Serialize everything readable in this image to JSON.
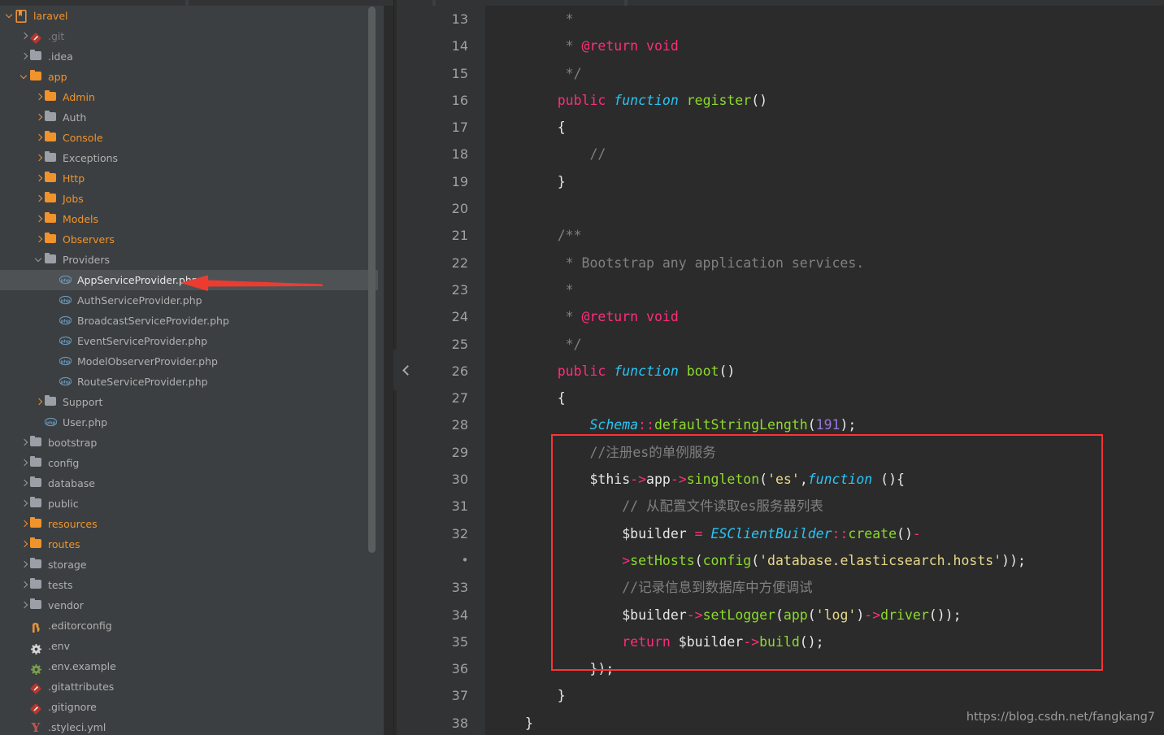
{
  "window": {
    "watermark": "https://blog.csdn.net/fangkang7"
  },
  "sidebar": {
    "scrollbar_label": "project-tree-scrollbar",
    "tree": [
      {
        "label": "laravel",
        "depth": 0,
        "icon": "module-book-icon",
        "arrow": "open-orange",
        "color": "orange",
        "selected": false
      },
      {
        "label": ".git",
        "depth": 1,
        "icon": "git-icon",
        "arrow": "closed",
        "color": "dim",
        "selected": false
      },
      {
        "label": ".idea",
        "depth": 1,
        "icon": "folder-grey-icon",
        "arrow": "closed",
        "color": "grey",
        "selected": false
      },
      {
        "label": "app",
        "depth": 1,
        "icon": "folder-orange-icon",
        "arrow": "open-orange",
        "color": "orange",
        "selected": false
      },
      {
        "label": "Admin",
        "depth": 2,
        "icon": "folder-orange-icon",
        "arrow": "closed-orange",
        "color": "orange",
        "selected": false
      },
      {
        "label": "Auth",
        "depth": 2,
        "icon": "folder-grey-icon",
        "arrow": "closed-orange",
        "color": "grey",
        "selected": false
      },
      {
        "label": "Console",
        "depth": 2,
        "icon": "folder-orange-icon",
        "arrow": "closed-orange",
        "color": "orange",
        "selected": false
      },
      {
        "label": "Exceptions",
        "depth": 2,
        "icon": "folder-grey-icon",
        "arrow": "closed-orange",
        "color": "grey",
        "selected": false
      },
      {
        "label": "Http",
        "depth": 2,
        "icon": "folder-orange-icon",
        "arrow": "closed-orange",
        "color": "orange",
        "selected": false
      },
      {
        "label": "Jobs",
        "depth": 2,
        "icon": "folder-orange-icon",
        "arrow": "closed-orange",
        "color": "orange",
        "selected": false
      },
      {
        "label": "Models",
        "depth": 2,
        "icon": "folder-orange-icon",
        "arrow": "closed-orange",
        "color": "orange",
        "selected": false
      },
      {
        "label": "Observers",
        "depth": 2,
        "icon": "folder-orange-icon",
        "arrow": "closed-orange",
        "color": "orange",
        "selected": false
      },
      {
        "label": "Providers",
        "depth": 2,
        "icon": "folder-grey-icon",
        "arrow": "open",
        "color": "grey",
        "selected": false
      },
      {
        "label": "AppServiceProvider.php",
        "depth": 3,
        "icon": "php-file-icon",
        "arrow": "none",
        "color": "white",
        "selected": true
      },
      {
        "label": "AuthServiceProvider.php",
        "depth": 3,
        "icon": "php-file-icon",
        "arrow": "none",
        "color": "grey",
        "selected": false
      },
      {
        "label": "BroadcastServiceProvider.php",
        "depth": 3,
        "icon": "php-file-icon",
        "arrow": "none",
        "color": "grey",
        "selected": false
      },
      {
        "label": "EventServiceProvider.php",
        "depth": 3,
        "icon": "php-file-icon",
        "arrow": "none",
        "color": "grey",
        "selected": false
      },
      {
        "label": "ModelObserverProvider.php",
        "depth": 3,
        "icon": "php-file-icon",
        "arrow": "none",
        "color": "grey",
        "selected": false
      },
      {
        "label": "RouteServiceProvider.php",
        "depth": 3,
        "icon": "php-file-icon",
        "arrow": "none",
        "color": "grey",
        "selected": false
      },
      {
        "label": "Support",
        "depth": 2,
        "icon": "folder-grey-icon",
        "arrow": "closed-orange",
        "color": "grey",
        "selected": false
      },
      {
        "label": "User.php",
        "depth": 2,
        "icon": "php-file-icon",
        "arrow": "none",
        "color": "grey",
        "selected": false
      },
      {
        "label": "bootstrap",
        "depth": 1,
        "icon": "folder-grey-icon",
        "arrow": "closed",
        "color": "grey",
        "selected": false
      },
      {
        "label": "config",
        "depth": 1,
        "icon": "folder-grey-icon",
        "arrow": "closed",
        "color": "grey",
        "selected": false
      },
      {
        "label": "database",
        "depth": 1,
        "icon": "folder-grey-icon",
        "arrow": "closed",
        "color": "grey",
        "selected": false
      },
      {
        "label": "public",
        "depth": 1,
        "icon": "folder-grey-icon",
        "arrow": "closed",
        "color": "grey",
        "selected": false
      },
      {
        "label": "resources",
        "depth": 1,
        "icon": "folder-orange-icon",
        "arrow": "closed-orange",
        "color": "orange",
        "selected": false
      },
      {
        "label": "routes",
        "depth": 1,
        "icon": "folder-orange-icon",
        "arrow": "closed-orange",
        "color": "orange",
        "selected": false
      },
      {
        "label": "storage",
        "depth": 1,
        "icon": "folder-grey-icon",
        "arrow": "closed",
        "color": "grey",
        "selected": false
      },
      {
        "label": "tests",
        "depth": 1,
        "icon": "folder-grey-icon",
        "arrow": "closed",
        "color": "grey",
        "selected": false
      },
      {
        "label": "vendor",
        "depth": 1,
        "icon": "folder-grey-icon",
        "arrow": "closed",
        "color": "grey",
        "selected": false
      },
      {
        "label": ".editorconfig",
        "depth": 1,
        "icon": "editorconfig-icon",
        "arrow": "none",
        "color": "grey",
        "selected": false
      },
      {
        "label": ".env",
        "depth": 1,
        "icon": "gear-white-icon",
        "arrow": "none",
        "color": "grey",
        "selected": false
      },
      {
        "label": ".env.example",
        "depth": 1,
        "icon": "gear-green-icon",
        "arrow": "none",
        "color": "grey",
        "selected": false
      },
      {
        "label": ".gitattributes",
        "depth": 1,
        "icon": "git-icon",
        "arrow": "none",
        "color": "grey",
        "selected": false
      },
      {
        "label": ".gitignore",
        "depth": 1,
        "icon": "git-icon",
        "arrow": "none",
        "color": "grey",
        "selected": false
      },
      {
        "label": ".styleci.yml",
        "depth": 1,
        "icon": "styleci-icon",
        "arrow": "none",
        "color": "grey",
        "selected": false
      }
    ]
  },
  "annotation": {
    "arrow_color": "#ee3b30",
    "arrow_target": "AppServiceProvider.php",
    "box_color": "#ff3333",
    "box_note": "highlighted-es-singleton-registration-block"
  },
  "editor": {
    "file": "AppServiceProvider.php",
    "first_line": 13,
    "last_line": 38,
    "lines": [
      {
        "num": "13",
        "indent": 0,
        "tokens": [
          {
            "t": "     ",
            "c": "pn"
          },
          {
            "t": "*",
            "c": "cm"
          }
        ]
      },
      {
        "num": "14",
        "indent": 0,
        "tokens": [
          {
            "t": "     ",
            "c": "pn"
          },
          {
            "t": "* ",
            "c": "cm"
          },
          {
            "t": "@return void",
            "c": "doc"
          }
        ]
      },
      {
        "num": "15",
        "indent": 0,
        "tokens": [
          {
            "t": "     ",
            "c": "pn"
          },
          {
            "t": "*/",
            "c": "cm"
          }
        ]
      },
      {
        "num": "16",
        "indent": 0,
        "tokens": [
          {
            "t": "    ",
            "c": "pn"
          },
          {
            "t": "public ",
            "c": "k"
          },
          {
            "t": "function ",
            "c": "fn"
          },
          {
            "t": "register",
            "c": "mth"
          },
          {
            "t": "()",
            "c": "pn"
          }
        ]
      },
      {
        "num": "17",
        "indent": 0,
        "tokens": [
          {
            "t": "    {",
            "c": "pn"
          }
        ]
      },
      {
        "num": "18",
        "indent": 0,
        "tokens": [
          {
            "t": "        ",
            "c": "pn"
          },
          {
            "t": "//",
            "c": "cm"
          }
        ]
      },
      {
        "num": "19",
        "indent": 0,
        "tokens": [
          {
            "t": "    }",
            "c": "pn"
          }
        ]
      },
      {
        "num": "20",
        "indent": 0,
        "tokens": []
      },
      {
        "num": "21",
        "indent": 0,
        "tokens": [
          {
            "t": "    ",
            "c": "pn"
          },
          {
            "t": "/**",
            "c": "cm"
          }
        ]
      },
      {
        "num": "22",
        "indent": 0,
        "tokens": [
          {
            "t": "     ",
            "c": "pn"
          },
          {
            "t": "* Bootstrap any application services.",
            "c": "cm"
          }
        ]
      },
      {
        "num": "23",
        "indent": 0,
        "tokens": [
          {
            "t": "     ",
            "c": "pn"
          },
          {
            "t": "*",
            "c": "cm"
          }
        ]
      },
      {
        "num": "24",
        "indent": 0,
        "tokens": [
          {
            "t": "     ",
            "c": "pn"
          },
          {
            "t": "* ",
            "c": "cm"
          },
          {
            "t": "@return void",
            "c": "doc"
          }
        ]
      },
      {
        "num": "25",
        "indent": 0,
        "tokens": [
          {
            "t": "     ",
            "c": "pn"
          },
          {
            "t": "*/",
            "c": "cm"
          }
        ]
      },
      {
        "num": "26",
        "indent": 0,
        "tokens": [
          {
            "t": "    ",
            "c": "pn"
          },
          {
            "t": "public ",
            "c": "k"
          },
          {
            "t": "function ",
            "c": "fn"
          },
          {
            "t": "boot",
            "c": "mth"
          },
          {
            "t": "()",
            "c": "pn"
          }
        ]
      },
      {
        "num": "27",
        "indent": 0,
        "tokens": [
          {
            "t": "    {",
            "c": "pn"
          }
        ]
      },
      {
        "num": "28",
        "indent": 0,
        "tokens": [
          {
            "t": "        ",
            "c": "pn"
          },
          {
            "t": "Schema",
            "c": "cls"
          },
          {
            "t": "::",
            "c": "sc"
          },
          {
            "t": "defaultStringLength",
            "c": "mth"
          },
          {
            "t": "(",
            "c": "pn"
          },
          {
            "t": "191",
            "c": "num2"
          },
          {
            "t": ");",
            "c": "pn"
          }
        ]
      },
      {
        "num": "29",
        "indent": 0,
        "tokens": [
          {
            "t": "        ",
            "c": "pn"
          },
          {
            "t": "//注册es的单例服务",
            "c": "cmz"
          }
        ]
      },
      {
        "num": "30",
        "indent": 0,
        "tokens": [
          {
            "t": "        ",
            "c": "pn"
          },
          {
            "t": "$this",
            "c": "pn"
          },
          {
            "t": "->",
            "c": "op"
          },
          {
            "t": "app",
            "c": "pn"
          },
          {
            "t": "->",
            "c": "op"
          },
          {
            "t": "singleton",
            "c": "mth"
          },
          {
            "t": "(",
            "c": "pn"
          },
          {
            "t": "'es'",
            "c": "str"
          },
          {
            "t": ",",
            "c": "pn"
          },
          {
            "t": "function",
            "c": "fn"
          },
          {
            "t": " (){",
            "c": "pn"
          }
        ]
      },
      {
        "num": "31",
        "indent": 0,
        "tokens": [
          {
            "t": "            ",
            "c": "pn"
          },
          {
            "t": "// 从配置文件读取es服务器列表",
            "c": "cmz"
          }
        ]
      },
      {
        "num": "32",
        "indent": 0,
        "tokens": [
          {
            "t": "            ",
            "c": "pn"
          },
          {
            "t": "$builder",
            "c": "pn"
          },
          {
            "t": " ",
            "c": "pn"
          },
          {
            "t": "=",
            "c": "op"
          },
          {
            "t": " ",
            "c": "pn"
          },
          {
            "t": "ESClientBuilder",
            "c": "cls"
          },
          {
            "t": "::",
            "c": "sc"
          },
          {
            "t": "create",
            "c": "mth"
          },
          {
            "t": "()",
            "c": "pn"
          },
          {
            "t": "-",
            "c": "op"
          }
        ]
      },
      {
        "num": "•",
        "wrap": true,
        "indent": 0,
        "tokens": [
          {
            "t": "            ",
            "c": "pn"
          },
          {
            "t": ">",
            "c": "op"
          },
          {
            "t": "setHosts",
            "c": "mth"
          },
          {
            "t": "(",
            "c": "pn"
          },
          {
            "t": "config",
            "c": "mth"
          },
          {
            "t": "(",
            "c": "pn"
          },
          {
            "t": "'database.elasticsearch.hosts'",
            "c": "str"
          },
          {
            "t": "));",
            "c": "pn"
          }
        ]
      },
      {
        "num": "33",
        "indent": 0,
        "tokens": [
          {
            "t": "            ",
            "c": "pn"
          },
          {
            "t": "//记录信息到数据库中方便调试",
            "c": "cmz"
          }
        ]
      },
      {
        "num": "34",
        "indent": 0,
        "tokens": [
          {
            "t": "            ",
            "c": "pn"
          },
          {
            "t": "$builder",
            "c": "pn"
          },
          {
            "t": "->",
            "c": "op"
          },
          {
            "t": "setLogger",
            "c": "mth"
          },
          {
            "t": "(",
            "c": "pn"
          },
          {
            "t": "app",
            "c": "mth"
          },
          {
            "t": "(",
            "c": "pn"
          },
          {
            "t": "'log'",
            "c": "str"
          },
          {
            "t": ")",
            "c": "pn"
          },
          {
            "t": "->",
            "c": "op"
          },
          {
            "t": "driver",
            "c": "mth"
          },
          {
            "t": "());",
            "c": "pn"
          }
        ]
      },
      {
        "num": "35",
        "indent": 0,
        "tokens": [
          {
            "t": "            ",
            "c": "pn"
          },
          {
            "t": "return ",
            "c": "k"
          },
          {
            "t": "$builder",
            "c": "pn"
          },
          {
            "t": "->",
            "c": "op"
          },
          {
            "t": "build",
            "c": "mth"
          },
          {
            "t": "();",
            "c": "pn"
          }
        ]
      },
      {
        "num": "36",
        "indent": 0,
        "tokens": [
          {
            "t": "        });",
            "c": "pn"
          }
        ]
      },
      {
        "num": "37",
        "indent": 0,
        "tokens": [
          {
            "t": "    }",
            "c": "pn"
          }
        ]
      },
      {
        "num": "38",
        "indent": 0,
        "tokens": [
          {
            "t": "}",
            "c": "pn"
          }
        ]
      }
    ]
  },
  "collapse_handle": {
    "name": "collapse-sidebar-chevron"
  }
}
